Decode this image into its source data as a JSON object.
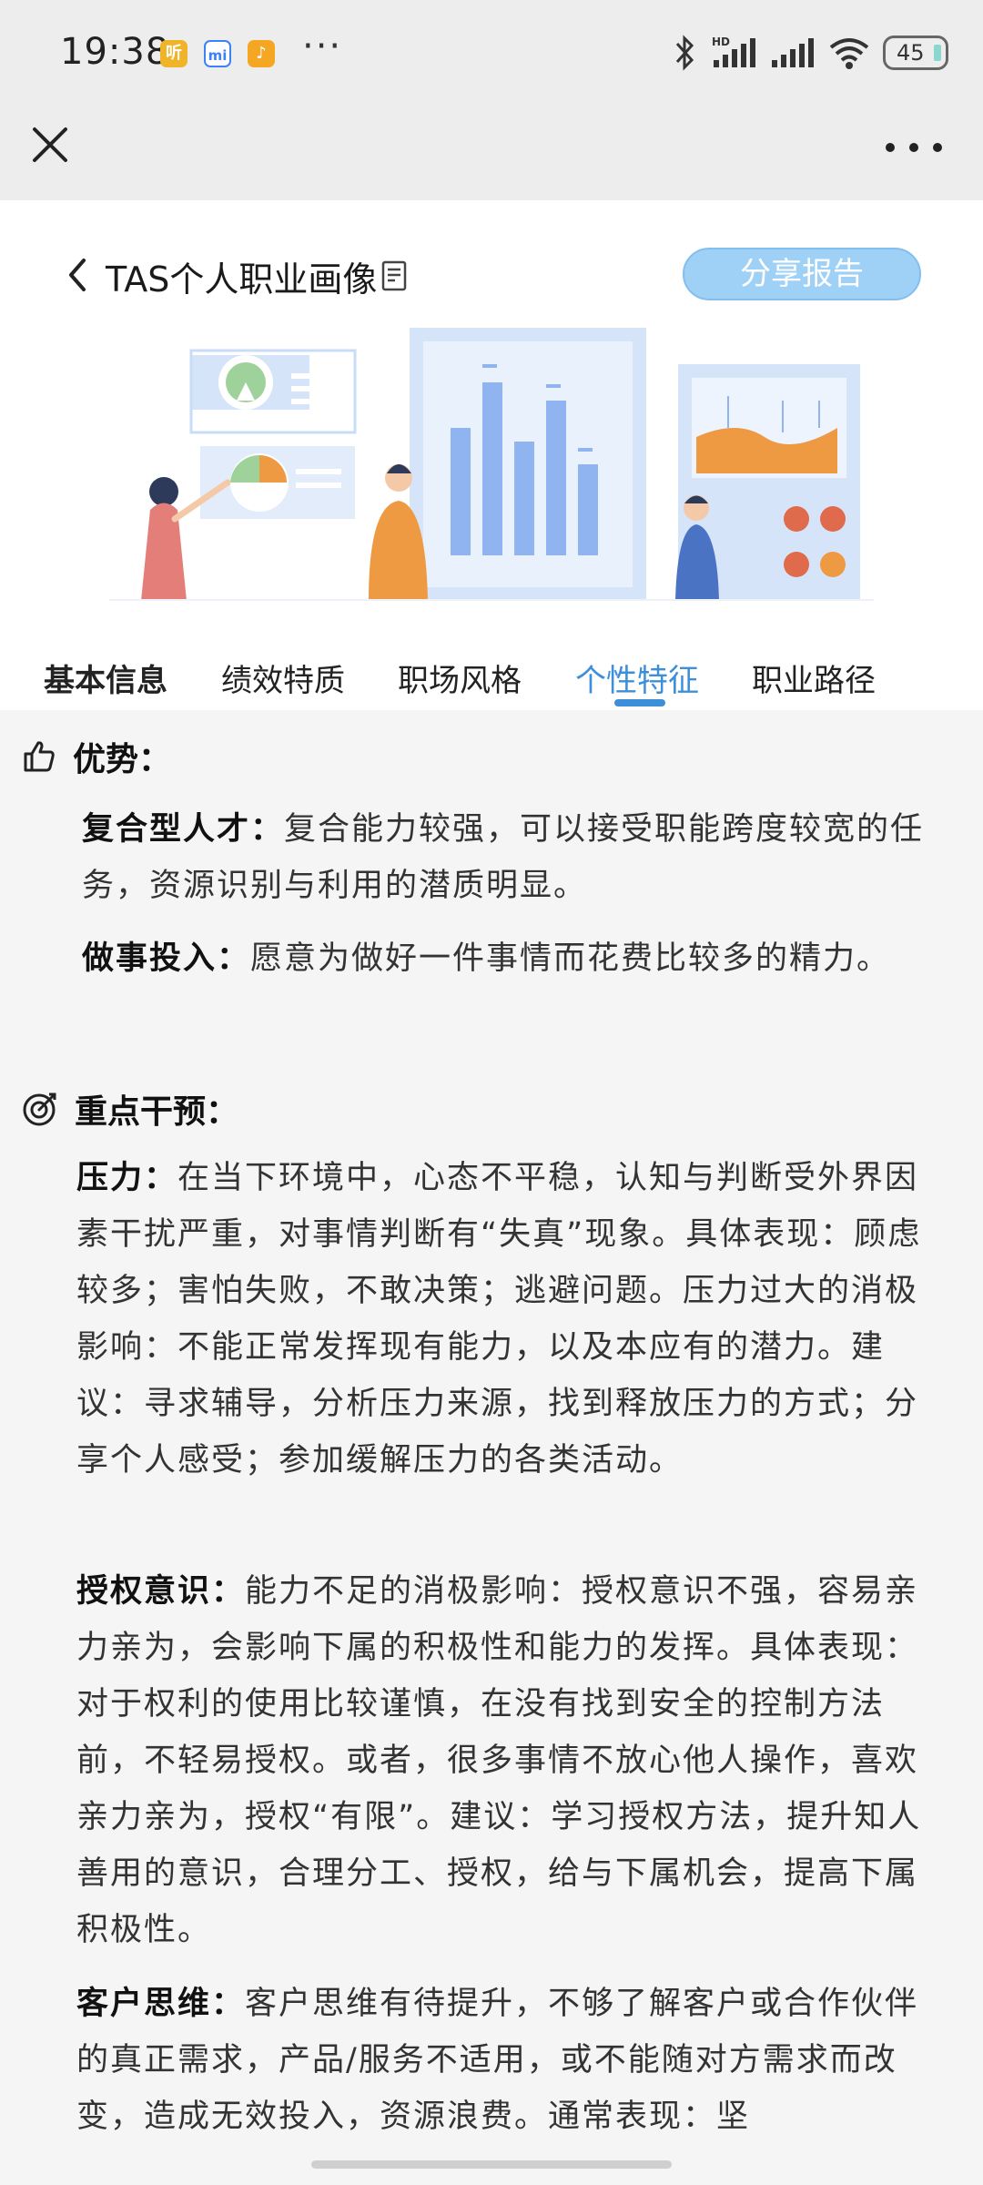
{
  "status_bar": {
    "time": "19:38",
    "app_icons": [
      {
        "name": "app-notification-icon-1",
        "glyph": "听",
        "color": "#f0b429"
      },
      {
        "name": "mi-icon",
        "glyph": "mi",
        "color": "#3b82f6"
      },
      {
        "name": "douyin-icon",
        "glyph": "♪",
        "color": "#f5a623"
      }
    ],
    "more": "···",
    "battery": "45"
  },
  "header": {
    "title": "TAS个人职业画像",
    "share_label": "分享报告"
  },
  "tabs": [
    {
      "label": "基本信息"
    },
    {
      "label": "绩效特质"
    },
    {
      "label": "职场风格"
    },
    {
      "label": "个性特征"
    },
    {
      "label": "职业路径"
    }
  ],
  "active_tab": "个性特征",
  "sections": {
    "advantages": {
      "heading": "优势：",
      "items": [
        {
          "keyword": "复合型人才：",
          "text": "复合能力较强，可以接受职能跨度较宽的任务，资源识别与利用的潜质明显。"
        },
        {
          "keyword": "做事投入：",
          "text": "愿意为做好一件事情而花费比较多的精力。"
        }
      ]
    },
    "intervention": {
      "heading": "重点干预：",
      "items": [
        {
          "keyword": "压力：",
          "text": "在当下环境中，心态不平稳，认知与判断受外界因素干扰严重，对事情判断有“失真”现象。具体表现：顾虑较多；害怕失败，不敢决策；逃避问题。压力过大的消极影响：不能正常发挥现有能力，以及本应有的潜力。建议：寻求辅导，分析压力来源，找到释放压力的方式；分享个人感受；参加缓解压力的各类活动。"
        },
        {
          "keyword": "授权意识：",
          "text": "能力不足的消极影响：授权意识不强，容易亲力亲为，会影响下属的积极性和能力的发挥。具体表现：对于权利的使用比较谨慎，在没有找到安全的控制方法前，不轻易授权。或者，很多事情不放心他人操作，喜欢亲力亲为，授权“有限”。建议：学习授权方法，提升知人善用的意识，合理分工、授权，给与下属机会，提高下属积极性。"
        },
        {
          "keyword": "客户思维：",
          "text": "客户思维有待提升，不够了解客户或合作伙伴的真正需求，产品/服务不适用，或不能随对方需求而改变，造成无效投入，资源浪费。通常表现：坚"
        }
      ]
    }
  },
  "colors": {
    "accent": "#3d8fd9",
    "share_button": "#9fd0f5",
    "illustration_blue": "#c9dcf7",
    "illustration_orange": "#ee9a43"
  }
}
